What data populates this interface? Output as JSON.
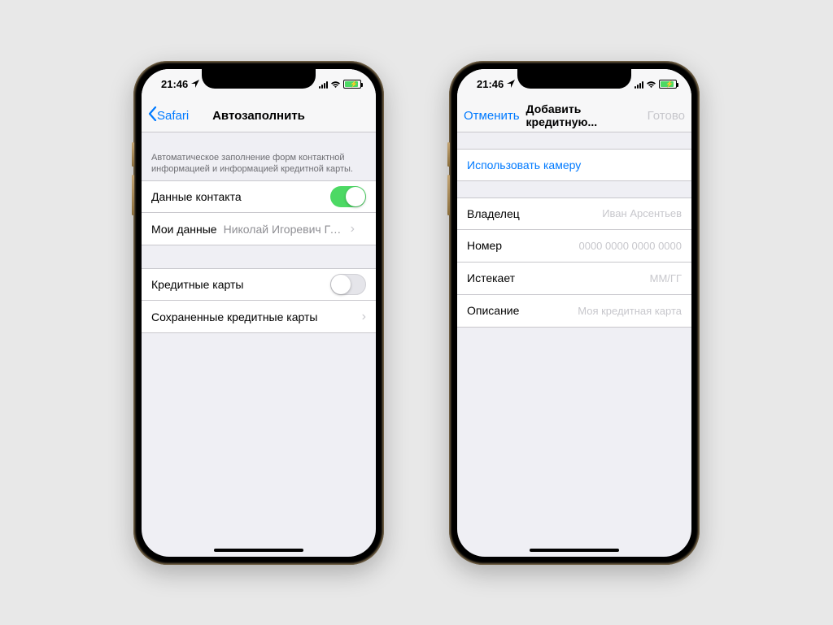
{
  "statusbar": {
    "time": "21:46"
  },
  "phone1": {
    "back": "Safari",
    "title": "Автозаполнить",
    "note": "Автоматическое заполнение форм контактной информацией и информацией кредитной карты.",
    "rows": {
      "contactData": "Данные контакта",
      "myData": "Мои данные",
      "myDataVal": "Николай Игоревич Грица...",
      "creditCards": "Кредитные карты",
      "savedCards": "Сохраненные кредитные карты"
    }
  },
  "phone2": {
    "cancel": "Отменить",
    "title": "Добавить кредитную...",
    "done": "Готово",
    "useCamera": "Использовать камеру",
    "fields": {
      "owner": "Владелец",
      "ownerPh": "Иван Арсентьев",
      "number": "Номер",
      "numberPh": "0000 0000 0000 0000",
      "expires": "Истекает",
      "expiresPh": "ММ/ГГ",
      "desc": "Описание",
      "descPh": "Моя кредитная карта"
    }
  }
}
